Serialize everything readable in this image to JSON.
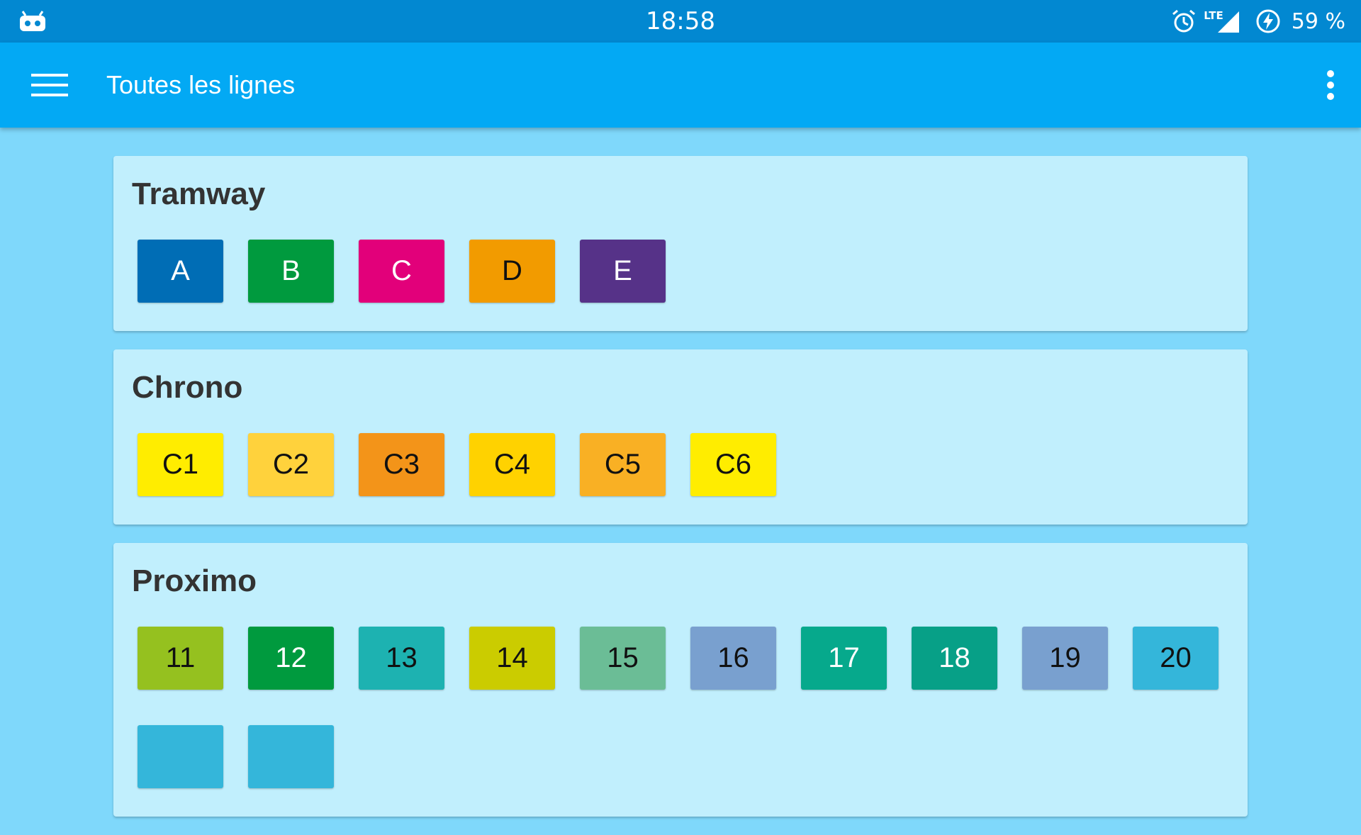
{
  "status_bar": {
    "time": "18:58",
    "network_label": "LTE",
    "battery": "59 %",
    "left_icon": "cyanogen-mod-icon",
    "icons": [
      "alarm-icon",
      "signal-icon",
      "battery-charging-icon"
    ]
  },
  "app_bar": {
    "title": "Toutes les lignes",
    "menu_icon": "hamburger-menu-icon",
    "overflow_icon": "more-vertical-icon",
    "background": "#03a9f4"
  },
  "sections": [
    {
      "title": "Tramway",
      "lines": [
        {
          "label": "A",
          "bg": "#006db5",
          "fg": "#ffffff"
        },
        {
          "label": "B",
          "bg": "#009a3e",
          "fg": "#ffffff"
        },
        {
          "label": "C",
          "bg": "#e2007a",
          "fg": "#ffffff"
        },
        {
          "label": "D",
          "bg": "#f29b00",
          "fg": "#111111"
        },
        {
          "label": "E",
          "bg": "#563288",
          "fg": "#ffffff"
        }
      ]
    },
    {
      "title": "Chrono",
      "lines": [
        {
          "label": "C1",
          "bg": "#ffed00",
          "fg": "#111111"
        },
        {
          "label": "C2",
          "bg": "#ffd23c",
          "fg": "#111111"
        },
        {
          "label": "C3",
          "bg": "#f39419",
          "fg": "#111111"
        },
        {
          "label": "C4",
          "bg": "#ffd200",
          "fg": "#111111"
        },
        {
          "label": "C5",
          "bg": "#f9b024",
          "fg": "#111111"
        },
        {
          "label": "C6",
          "bg": "#ffed00",
          "fg": "#111111"
        }
      ]
    },
    {
      "title": "Proximo",
      "lines": [
        {
          "label": "11",
          "bg": "#95c11f",
          "fg": "#111111"
        },
        {
          "label": "12",
          "bg": "#009a3e",
          "fg": "#ffffff"
        },
        {
          "label": "13",
          "bg": "#1db2b1",
          "fg": "#111111"
        },
        {
          "label": "14",
          "bg": "#cbcc00",
          "fg": "#111111"
        },
        {
          "label": "15",
          "bg": "#6bbd96",
          "fg": "#111111"
        },
        {
          "label": "16",
          "bg": "#79a0cf",
          "fg": "#111111"
        },
        {
          "label": "17",
          "bg": "#06a98c",
          "fg": "#ffffff"
        },
        {
          "label": "18",
          "bg": "#07a087",
          "fg": "#ffffff"
        },
        {
          "label": "19",
          "bg": "#79a0cf",
          "fg": "#111111"
        },
        {
          "label": "20",
          "bg": "#34b6da",
          "fg": "#111111"
        },
        {
          "label": "",
          "bg": "#34b6da",
          "fg": "#111111"
        },
        {
          "label": "",
          "bg": "#34b6da",
          "fg": "#111111"
        }
      ]
    }
  ]
}
